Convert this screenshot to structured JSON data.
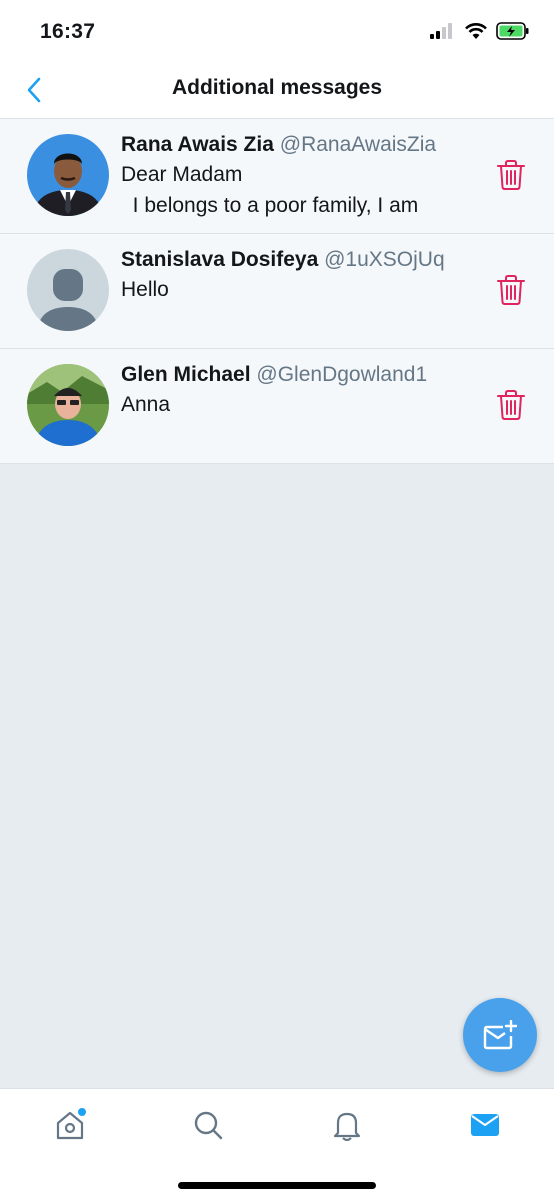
{
  "status_bar": {
    "time": "16:37"
  },
  "nav": {
    "title": "Additional messages"
  },
  "messages": [
    {
      "name": "Rana Awais Zia",
      "handle": "@RanaAwaisZia",
      "preview": "Dear Madam\n  I belongs to a poor family, I am"
    },
    {
      "name": "Stanislava Dosifeya",
      "handle": "@1uXSOjUq",
      "preview": "Hello"
    },
    {
      "name": "Glen Michael",
      "handle": "@GlenDgowland1",
      "preview": "Anna"
    }
  ],
  "icons": {
    "back": "chevron-left-icon",
    "delete": "trash-icon",
    "compose": "new-message-icon",
    "tabs": [
      "home-icon",
      "search-icon",
      "bell-icon",
      "envelope-icon"
    ]
  },
  "colors": {
    "accent": "#1da1f2",
    "delete": "#e0245e",
    "row_bg": "#f5f8fa",
    "page_bg": "#e6ecf0"
  }
}
